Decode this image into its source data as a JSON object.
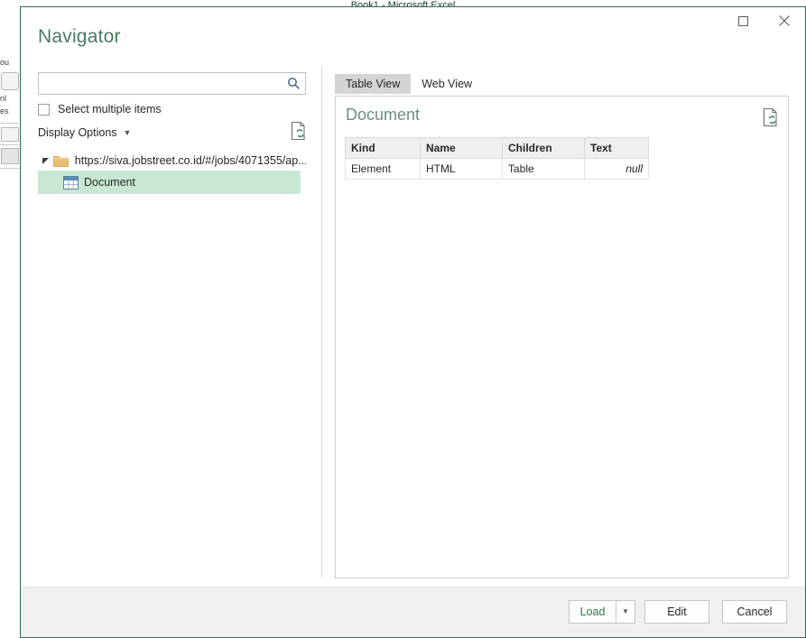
{
  "excel": {
    "window_title": "Book1 - Microsoft Excel",
    "left_fragments": [
      "ou",
      "nl",
      "es"
    ]
  },
  "dialog": {
    "title": "Navigator",
    "window_controls": {
      "maximize": "maximize-icon",
      "close": "close-icon"
    }
  },
  "left_pane": {
    "search": {
      "value": "",
      "placeholder": "",
      "icon": "search-icon"
    },
    "select_multiple": {
      "label": "Select multiple items",
      "checked": false
    },
    "display_options": {
      "label": "Display Options",
      "caret": "chevron-down-icon"
    },
    "refresh_icon": "refresh-document-icon",
    "tree": {
      "root": {
        "label": "https://siva.jobstreet.co.id/#/jobs/4071355/ap...",
        "icon": "folder-icon",
        "twisty": "collapse-triangle-icon",
        "expanded": true
      },
      "children": [
        {
          "label": "Document",
          "icon": "table-icon",
          "selected": true
        }
      ]
    }
  },
  "right_pane": {
    "tabs": [
      {
        "label": "Table View",
        "active": true
      },
      {
        "label": "Web View",
        "active": false
      }
    ],
    "heading": "Document",
    "refresh_icon": "refresh-document-icon",
    "preview": {
      "columns": [
        "Kind",
        "Name",
        "Children",
        "Text"
      ],
      "rows": [
        [
          "Element",
          "HTML",
          "Table",
          "null"
        ]
      ]
    }
  },
  "footer": {
    "load_label": "Load",
    "load_dropdown": "chevron-down-icon",
    "edit_label": "Edit",
    "cancel_label": "Cancel"
  },
  "colors": {
    "dialog_border": "#2f6b4f",
    "title_green": "#4a7a63",
    "selection_green": "#c8e8d4",
    "load_green": "#2f7a4f",
    "footer_gray": "#f0f0f0",
    "tab_active_gray": "#d4d4d4",
    "folder_tan": "#e8bf79"
  }
}
